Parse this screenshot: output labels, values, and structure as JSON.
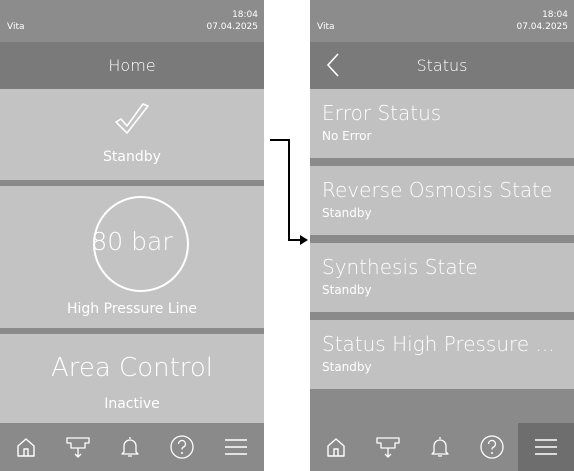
{
  "status_bar": {
    "brand": "Vita",
    "time": "18:04",
    "date": "07.04.2025"
  },
  "home": {
    "title": "Home",
    "tiles": [
      {
        "label": "Standby",
        "icon": "check-icon"
      },
      {
        "value": "80 bar",
        "label": "High Pressure Line"
      },
      {
        "title": "Area Control",
        "sub": "Inactive"
      }
    ]
  },
  "status": {
    "title": "Status",
    "items": [
      {
        "title": "Error Status",
        "sub": "No Error"
      },
      {
        "title": "Reverse Osmosis State",
        "sub": "Standby"
      },
      {
        "title": "Synthesis State",
        "sub": "Standby"
      },
      {
        "title": "Status High Pressure ...",
        "sub": "Standby"
      }
    ]
  },
  "nav": [
    "home-icon",
    "spray-nozzle-icon",
    "bell-icon",
    "help-icon",
    "menu-icon"
  ],
  "colors": {
    "tile": "#c3c3c3",
    "bar": "#8a8a8a",
    "title": "#7a7a7a",
    "active": "#6e6e6e"
  }
}
